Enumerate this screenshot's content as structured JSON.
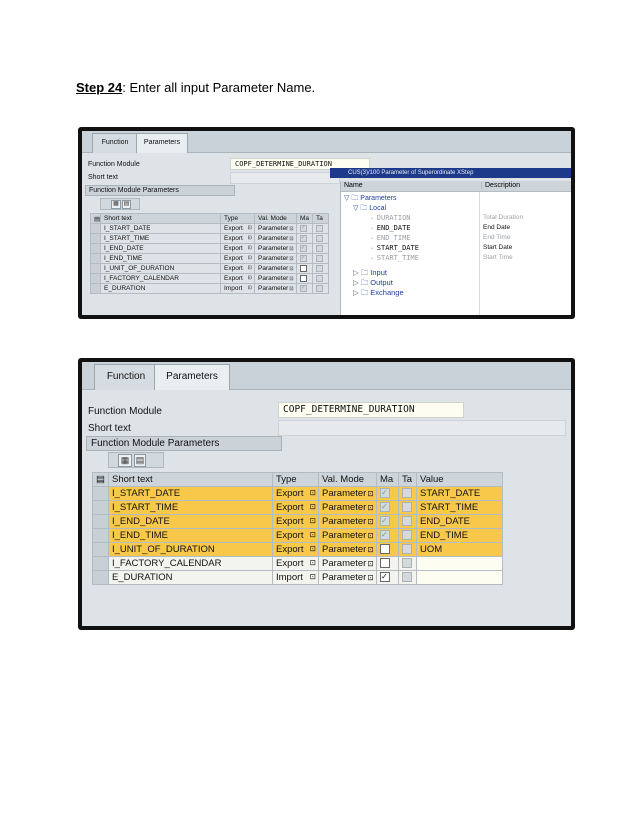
{
  "step": {
    "label": "Step 24",
    "text": ": Enter all input Parameter Name."
  },
  "tabs": {
    "function": "Function",
    "parameters": "Parameters"
  },
  "labels": {
    "function_module": "Function Module",
    "short_text": "Short text",
    "fm_params": "Function Module Parameters"
  },
  "function_module_value": "COPF_DETERMINE_DURATION",
  "columns": {
    "short_text": "Short text",
    "type": "Type",
    "val_mode": "Val. Mode",
    "ma": "Ma",
    "ta": "Ta",
    "value": "Value"
  },
  "params": [
    {
      "name": "I_START_DATE",
      "type": "Export",
      "mode": "Parameter",
      "ma": true,
      "value": "START_DATE"
    },
    {
      "name": "I_START_TIME",
      "type": "Export",
      "mode": "Parameter",
      "ma": true,
      "value": "START_TIME"
    },
    {
      "name": "I_END_DATE",
      "type": "Export",
      "mode": "Parameter",
      "ma": true,
      "value": "END_DATE"
    },
    {
      "name": "I_END_TIME",
      "type": "Export",
      "mode": "Parameter",
      "ma": true,
      "value": "END_TIME"
    },
    {
      "name": "I_UNIT_OF_DURATION",
      "type": "Export",
      "mode": "Parameter",
      "ma": false,
      "value": "UOM"
    },
    {
      "name": "I_FACTORY_CALENDAR",
      "type": "Export",
      "mode": "Parameter",
      "ma": false,
      "value": ""
    },
    {
      "name": "E_DURATION",
      "type": "Import",
      "mode": "Parameter",
      "ma": true,
      "value": ""
    }
  ],
  "tree": {
    "title": "CUS(3)/100 Parameter of Superordinate XStep",
    "col_name": "Name",
    "col_desc": "Description",
    "parameters": "Parameters",
    "local": "Local",
    "items": [
      {
        "name": "DURATION",
        "desc": "Total Duration",
        "active": false
      },
      {
        "name": "END_DATE",
        "desc": "End Date",
        "active": true
      },
      {
        "name": "END_TIME",
        "desc": "End Time",
        "active": false
      },
      {
        "name": "START_DATE",
        "desc": "Start Date",
        "active": true
      },
      {
        "name": "START_TIME",
        "desc": "Start Time",
        "active": false
      }
    ],
    "folders": [
      "Input",
      "Output",
      "Exchange"
    ]
  },
  "colors": {
    "highlight": "#f7c84a",
    "tree_title_bg": "#1d3a8a",
    "tree_link": "#1f3f9a"
  }
}
